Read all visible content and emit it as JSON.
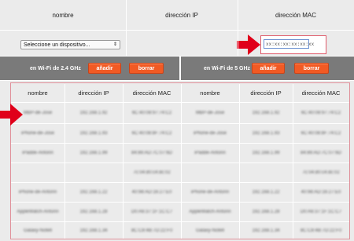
{
  "header": {
    "col_name": "nombre",
    "col_ip": "dirección IP",
    "col_mac": "dirección MAC"
  },
  "device_select": {
    "value": "Seleccione un dispositivo...",
    "chevron": "⇕"
  },
  "mac_input": {
    "placeholder": "xx:xx:xx:xx:xx:xx"
  },
  "wifi24": {
    "label": "en Wi-Fi de 2.4 GHz",
    "add_label": "añadir",
    "delete_label": "borrar"
  },
  "wifi5": {
    "label": "en Wi-Fi de 5 GHz",
    "add_label": "añadir",
    "delete_label": "borrar"
  },
  "table_headers": {
    "left": [
      "nombre",
      "dirección IP",
      "dirección MAC"
    ],
    "right": [
      "nombre",
      "dirección IP",
      "dirección MAC"
    ]
  },
  "rows_left": [
    [
      "MBP-de-Jose",
      "192.168.1.92",
      "6C:40:08:97:74:C2"
    ],
    [
      "iPhone-de-Jose",
      "192.168.1.93",
      "6C:40:08:8F:74:C2"
    ],
    [
      "iPadde-Antonn",
      "192.168.1.99",
      "84:89:AD:7C:07:6D"
    ],
    [
      "",
      "",
      "7c:04:d0:c4:dc:02"
    ],
    [
      "iPhone-de-Antonn",
      "192.168.1.22",
      "40:98:AD:16:27:E0"
    ],
    [
      "AppleWatch-Antonn",
      "192.168.1.28",
      "D0:A6:37:1F:1C:C7"
    ],
    [
      "Galaxy-Notell",
      "192.168.1.34",
      "8C:C8:4B:7D:22:F0"
    ]
  ],
  "rows_right": [
    [
      "MBP-de-Jose",
      "192.168.1.92",
      "6C:40:08:97:74:C2"
    ],
    [
      "iPhone-de-Jose",
      "192.168.1.93",
      "6C:40:08:8F:74:C2"
    ],
    [
      "iPadde-Antonn",
      "192.168.1.99",
      "84:89:AD:7C:07:6D"
    ],
    [
      "",
      "",
      "7c:04:d0:c4:dc:02"
    ],
    [
      "iPhone-de-Antonn",
      "192.168.1.22",
      "40:98:AD:16:27:E0"
    ],
    [
      "AppleWatch-Antonn",
      "192.168.1.28",
      "D0:A6:37:1F:1C:C7"
    ],
    [
      "Galaxy-Notell",
      "192.168.1.34",
      "8C:C8:4B:7D:22:F0"
    ]
  ],
  "colors": {
    "accent": "#f15a24",
    "annotation_red": "#e0001a",
    "bar_gray": "#7a7a7a",
    "cell_gray": "#ebebeb"
  }
}
